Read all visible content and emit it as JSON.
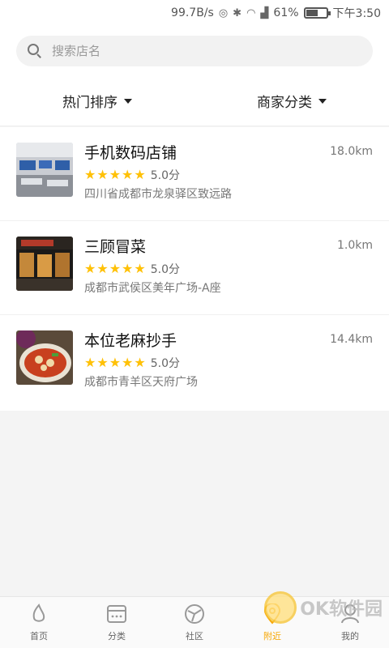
{
  "status_bar": {
    "net_speed": "99.7B/s",
    "battery_percent": "61%",
    "battery_level": 0.61,
    "time": "下午3:50"
  },
  "search": {
    "placeholder": "搜索店名"
  },
  "filters": [
    {
      "label": "热门排序"
    },
    {
      "label": "商家分类"
    }
  ],
  "shops": [
    {
      "name": "手机数码店铺",
      "rating": "5.0分",
      "stars": 5,
      "address": "四川省成都市龙泉驿区致远路",
      "distance": "18.0km"
    },
    {
      "name": "三顾冒菜",
      "rating": "5.0分",
      "stars": 5,
      "address": "成都市武侯区美年广场-A座",
      "distance": "1.0km"
    },
    {
      "name": "本位老麻抄手",
      "rating": "5.0分",
      "stars": 5,
      "address": "成都市青羊区天府广场",
      "distance": "14.4km"
    }
  ],
  "tabs": [
    {
      "label": "首页",
      "icon": "home-flame-icon"
    },
    {
      "label": "分类",
      "icon": "category-icon"
    },
    {
      "label": "社区",
      "icon": "community-icon"
    },
    {
      "label": "附近",
      "icon": "location-pin-icon",
      "active": true
    },
    {
      "label": "我的",
      "icon": "profile-icon"
    }
  ],
  "colors": {
    "accent": "#f7a600",
    "star": "#ffc107"
  },
  "watermark": {
    "text": "OK软件园"
  }
}
